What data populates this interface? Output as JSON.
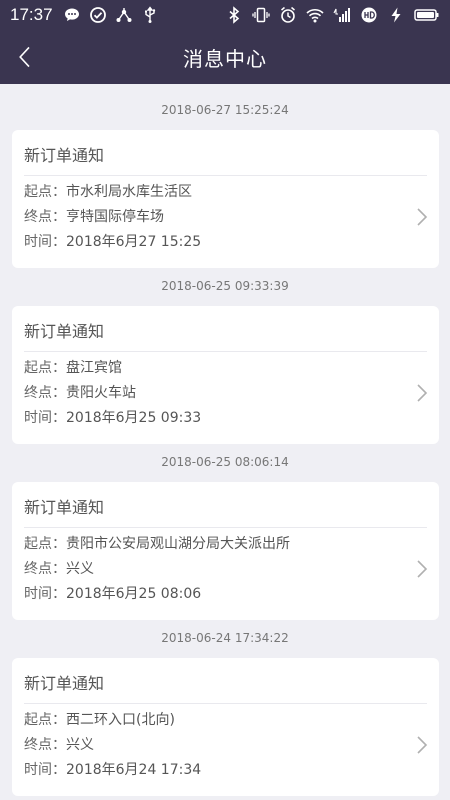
{
  "status_bar": {
    "time": "17:37",
    "left_icons": [
      "chat-bubble-icon",
      "check-circle-icon",
      "share-network-icon",
      "usb-icon"
    ],
    "right_icons": [
      "bluetooth-icon",
      "vibrate-icon",
      "alarm-icon",
      "wifi-icon",
      "signal-4g-icon",
      "hd-icon",
      "charging-icon",
      "battery-icon"
    ]
  },
  "nav": {
    "title": "消息中心",
    "back_icon": "chevron-left-icon"
  },
  "messages": [
    {
      "timestamp": "2018-06-27 15:25:24",
      "title": "新订单通知",
      "start_label": "起点：",
      "start": "市水利局水库生活区",
      "end_label": "终点：",
      "end": "亨特国际停车场",
      "time_label": "时间：",
      "time": "2018年6月27 15:25"
    },
    {
      "timestamp": "2018-06-25 09:33:39",
      "title": "新订单通知",
      "start_label": "起点：",
      "start": "盘江宾馆",
      "end_label": "终点：",
      "end": "贵阳火车站",
      "time_label": "时间：",
      "time": "2018年6月25 09:33"
    },
    {
      "timestamp": "2018-06-25 08:06:14",
      "title": "新订单通知",
      "start_label": "起点：",
      "start": "贵阳市公安局观山湖分局大关派出所",
      "end_label": "终点：",
      "end": "兴义",
      "time_label": "时间：",
      "time": "2018年6月25 08:06"
    },
    {
      "timestamp": "2018-06-24 17:34:22",
      "title": "新订单通知",
      "start_label": "起点：",
      "start": "西二环入口(北向)",
      "end_label": "终点：",
      "end": "兴义",
      "time_label": "时间：",
      "time": "2018年6月24 17:34"
    }
  ],
  "colors": {
    "header_bg": "#3a3550",
    "page_bg": "#efeff4",
    "card_bg": "#ffffff",
    "text": "#555555",
    "chevron": "#b0b0b0"
  }
}
